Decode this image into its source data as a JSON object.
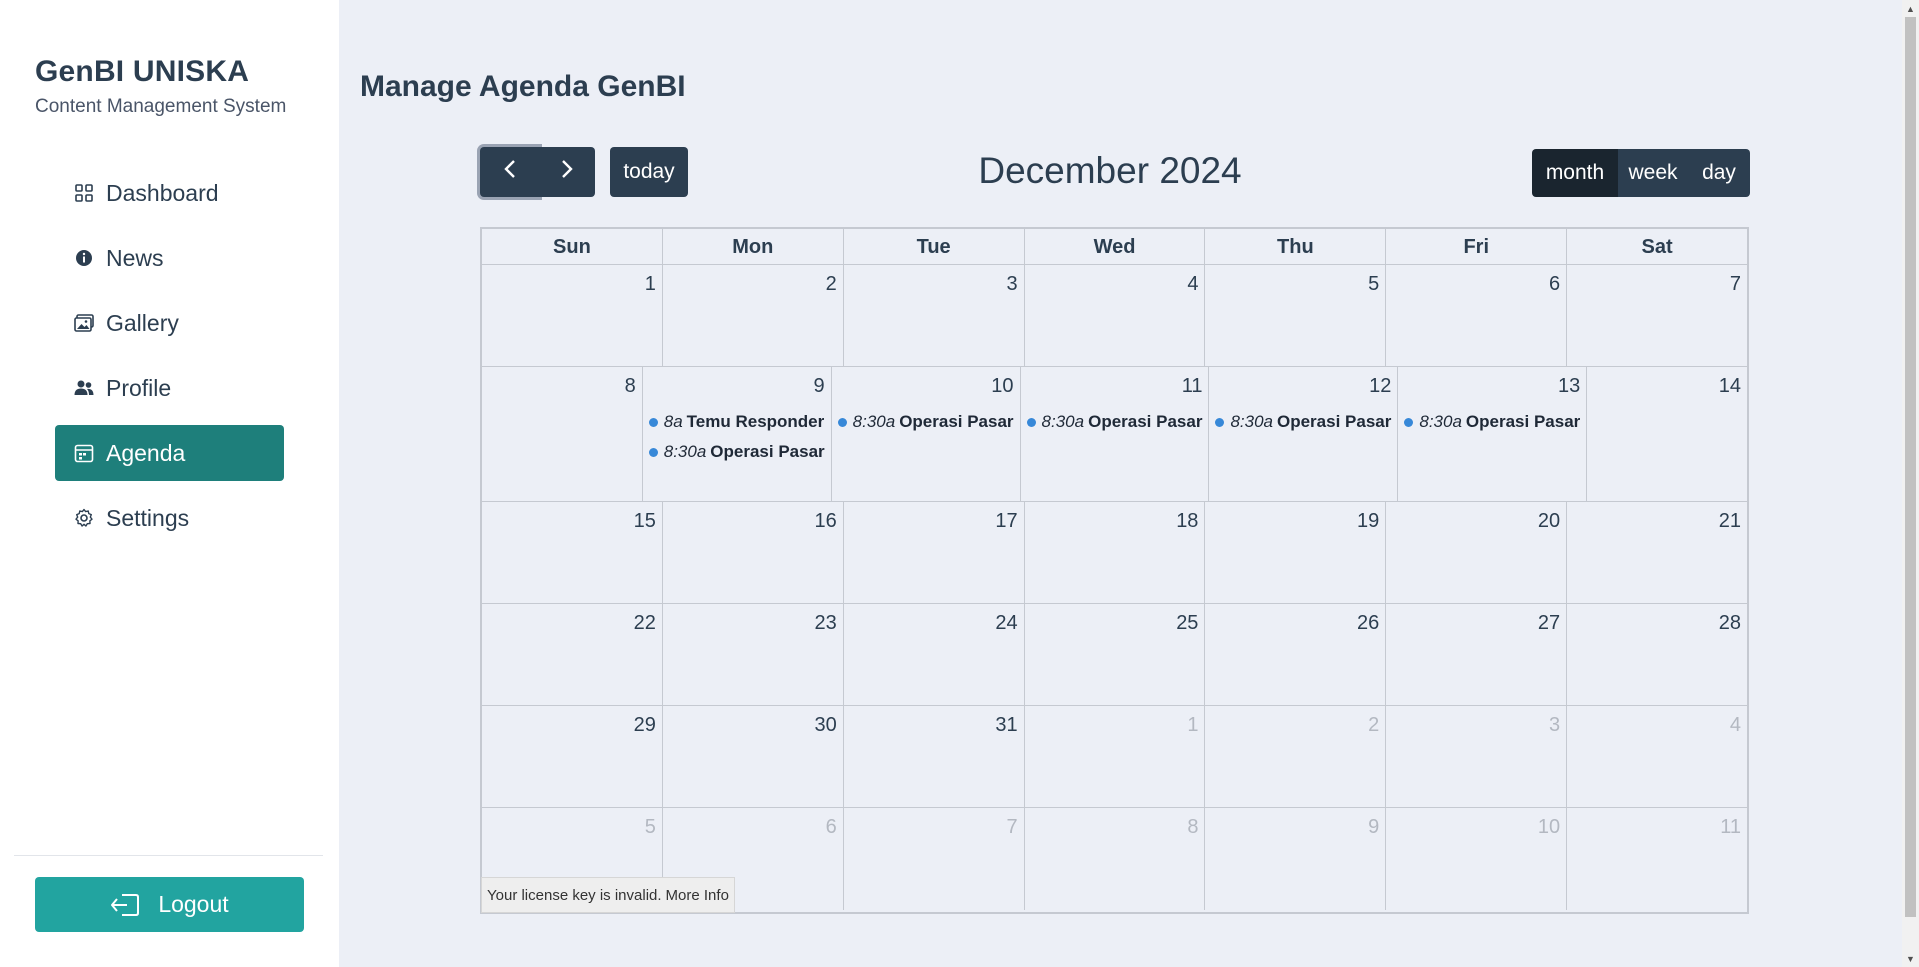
{
  "sidebar": {
    "brand_title": "GenBI UNISKA",
    "brand_subtitle": "Content Management System",
    "items": [
      {
        "label": "Dashboard",
        "icon": "grid-icon"
      },
      {
        "label": "News",
        "icon": "info-icon"
      },
      {
        "label": "Gallery",
        "icon": "image-icon"
      },
      {
        "label": "Profile",
        "icon": "users-icon"
      },
      {
        "label": "Agenda",
        "icon": "calendar-icon",
        "active": true
      },
      {
        "label": "Settings",
        "icon": "gear-icon"
      }
    ],
    "logout_label": "Logout"
  },
  "main": {
    "page_title": "Manage Agenda GenBI"
  },
  "calendar": {
    "title": "December 2024",
    "today_label": "today",
    "views": {
      "month": "month",
      "week": "week",
      "day": "day"
    },
    "active_view": "month",
    "days_of_week": [
      "Sun",
      "Mon",
      "Tue",
      "Wed",
      "Thu",
      "Fri",
      "Sat"
    ],
    "weeks": [
      [
        "1",
        "2",
        "3",
        "4",
        "5",
        "6",
        "7"
      ],
      [
        "8",
        "9",
        "10",
        "11",
        "12",
        "13",
        "14"
      ],
      [
        "15",
        "16",
        "17",
        "18",
        "19",
        "20",
        "21"
      ],
      [
        "22",
        "23",
        "24",
        "25",
        "26",
        "27",
        "28"
      ],
      [
        "29",
        "30",
        "31",
        "1",
        "2",
        "3",
        "4"
      ],
      [
        "5",
        "6",
        "7",
        "8",
        "9",
        "10",
        "11"
      ]
    ],
    "events": {
      "mon9_a": {
        "time": "8a",
        "title": "Temu Responder"
      },
      "mon9_b": {
        "time": "8:30a",
        "title": "Operasi Pasar"
      },
      "tue10": {
        "time": "8:30a",
        "title": "Operasi Pasar"
      },
      "wed11": {
        "time": "8:30a",
        "title": "Operasi Pasar"
      },
      "thu12": {
        "time": "8:30a",
        "title": "Operasi Pasar"
      },
      "fri13": {
        "time": "8:30a",
        "title": "Operasi Pasar"
      }
    },
    "event_color": "#3788d8",
    "license_text": "Your license key is invalid.",
    "license_link": "More Info"
  },
  "colors": {
    "accent_active": "#1e7f7b",
    "logout": "#22a4a0",
    "button_dark": "#2c3e50",
    "background": "#eceff6"
  }
}
